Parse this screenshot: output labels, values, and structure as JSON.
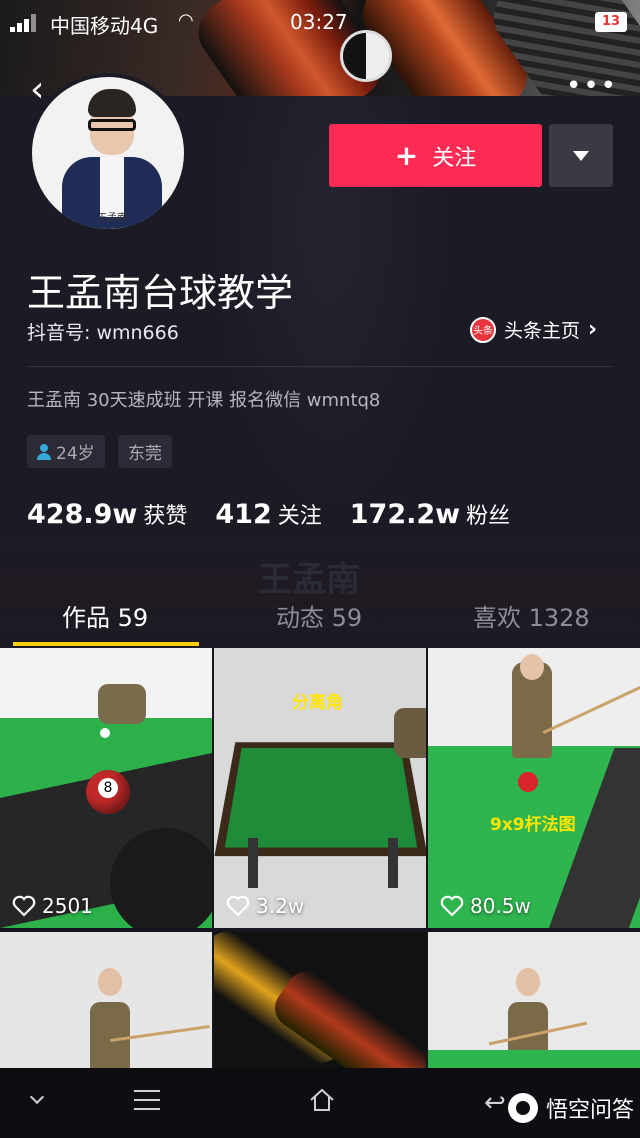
{
  "status_bar": {
    "carrier": "中国移动4G",
    "time": "03:27",
    "battery": "13"
  },
  "profile": {
    "avatar_caption": "王孟南",
    "follow_label": "关注",
    "nickname": "王孟南台球教学",
    "account_id": "抖音号: wmn666",
    "toutiao_label": "头条主页",
    "toutiao_icon_text": "头条",
    "bio": "王孟南  30天速成班 开课  报名微信 wmntq8",
    "tags": {
      "age": "24岁",
      "city": "东莞"
    },
    "stats": [
      {
        "num": "428.9w",
        "label": "获赞"
      },
      {
        "num": "412",
        "label": "关注"
      },
      {
        "num": "172.2w",
        "label": "粉丝"
      }
    ],
    "background_name": "王孟南"
  },
  "tabs": [
    {
      "label": "作品 59",
      "active": true
    },
    {
      "label": "动态 59",
      "active": false
    },
    {
      "label": "喜欢 1328",
      "active": false
    }
  ],
  "videos": [
    {
      "likes": "2501"
    },
    {
      "likes": "3.2w",
      "overlay": "分离角"
    },
    {
      "likes": "80.5w",
      "overlay": "9x9杆法图"
    },
    {
      "likes": ""
    },
    {
      "likes": ""
    },
    {
      "likes": ""
    }
  ],
  "watermark": "悟空问答",
  "colors": {
    "follow_button": "#fe2c55",
    "tab_underline": "#facf0f",
    "panel_background": "#1b1b25"
  },
  "icons": [
    "back-icon",
    "more-icon",
    "plus-icon",
    "dropdown-icon",
    "toutiao-icon",
    "chevron-right-icon",
    "person-icon",
    "heart-icon",
    "nav-down-icon",
    "nav-menu-icon",
    "nav-home-icon",
    "nav-back-icon"
  ]
}
